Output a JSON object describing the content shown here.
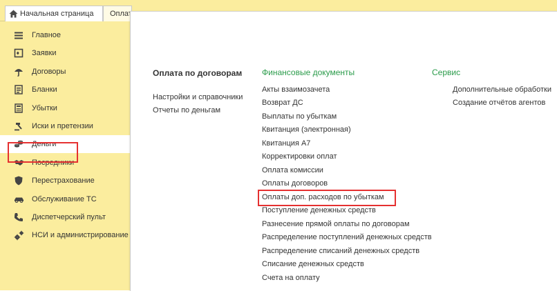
{
  "tabs": [
    {
      "label": "Начальная страница"
    },
    {
      "label": "Оплати"
    }
  ],
  "sidebar": {
    "items": [
      {
        "label": "Главное",
        "icon": "menu-icon"
      },
      {
        "label": "Заявки",
        "icon": "inbox-icon"
      },
      {
        "label": "Договоры",
        "icon": "umbrella-icon"
      },
      {
        "label": "Бланки",
        "icon": "form-icon"
      },
      {
        "label": "Убытки",
        "icon": "calculator-icon"
      },
      {
        "label": "Иски и претензии",
        "icon": "gavel-icon"
      },
      {
        "label": "Деньги",
        "icon": "coins-icon"
      },
      {
        "label": "Посредники",
        "icon": "handshake-icon"
      },
      {
        "label": "Перестрахование",
        "icon": "shield-icon"
      },
      {
        "label": "Обслуживание ТС",
        "icon": "car-icon"
      },
      {
        "label": "Диспетчерский пульт",
        "icon": "phone-icon"
      },
      {
        "label": "НСИ и администрирование",
        "icon": "gears-icon"
      }
    ],
    "active_index": 6
  },
  "panel": {
    "col1": {
      "title": "Оплата по договорам",
      "links": [
        "Настройки и справочники",
        "Отчеты по деньгам"
      ]
    },
    "col2": {
      "title": "Финансовые документы",
      "links": [
        "Акты взаимозачета",
        "Возврат ДС",
        "Выплаты по убыткам",
        "Квитанция (электронная)",
        "Квитанция А7",
        "Корректировки оплат",
        "Оплата комиссии",
        "Оплаты договоров",
        "Оплаты доп. расходов по убыткам",
        "Поступление денежных средств",
        "Разнесение прямой оплаты по договорам",
        "Распределение поступлений денежных средств",
        "Распределение списаний денежных средств",
        "Списание денежных средств",
        "Счета на оплату"
      ],
      "highlight_index": 8
    },
    "col3": {
      "title": "Сервис",
      "links": [
        "Дополнительные обработки",
        "Создание отчётов агентов"
      ]
    }
  },
  "colors": {
    "sidebar_bg": "#fbed9e",
    "accent_green": "#2a9b4a",
    "highlight_red": "#e53030"
  }
}
